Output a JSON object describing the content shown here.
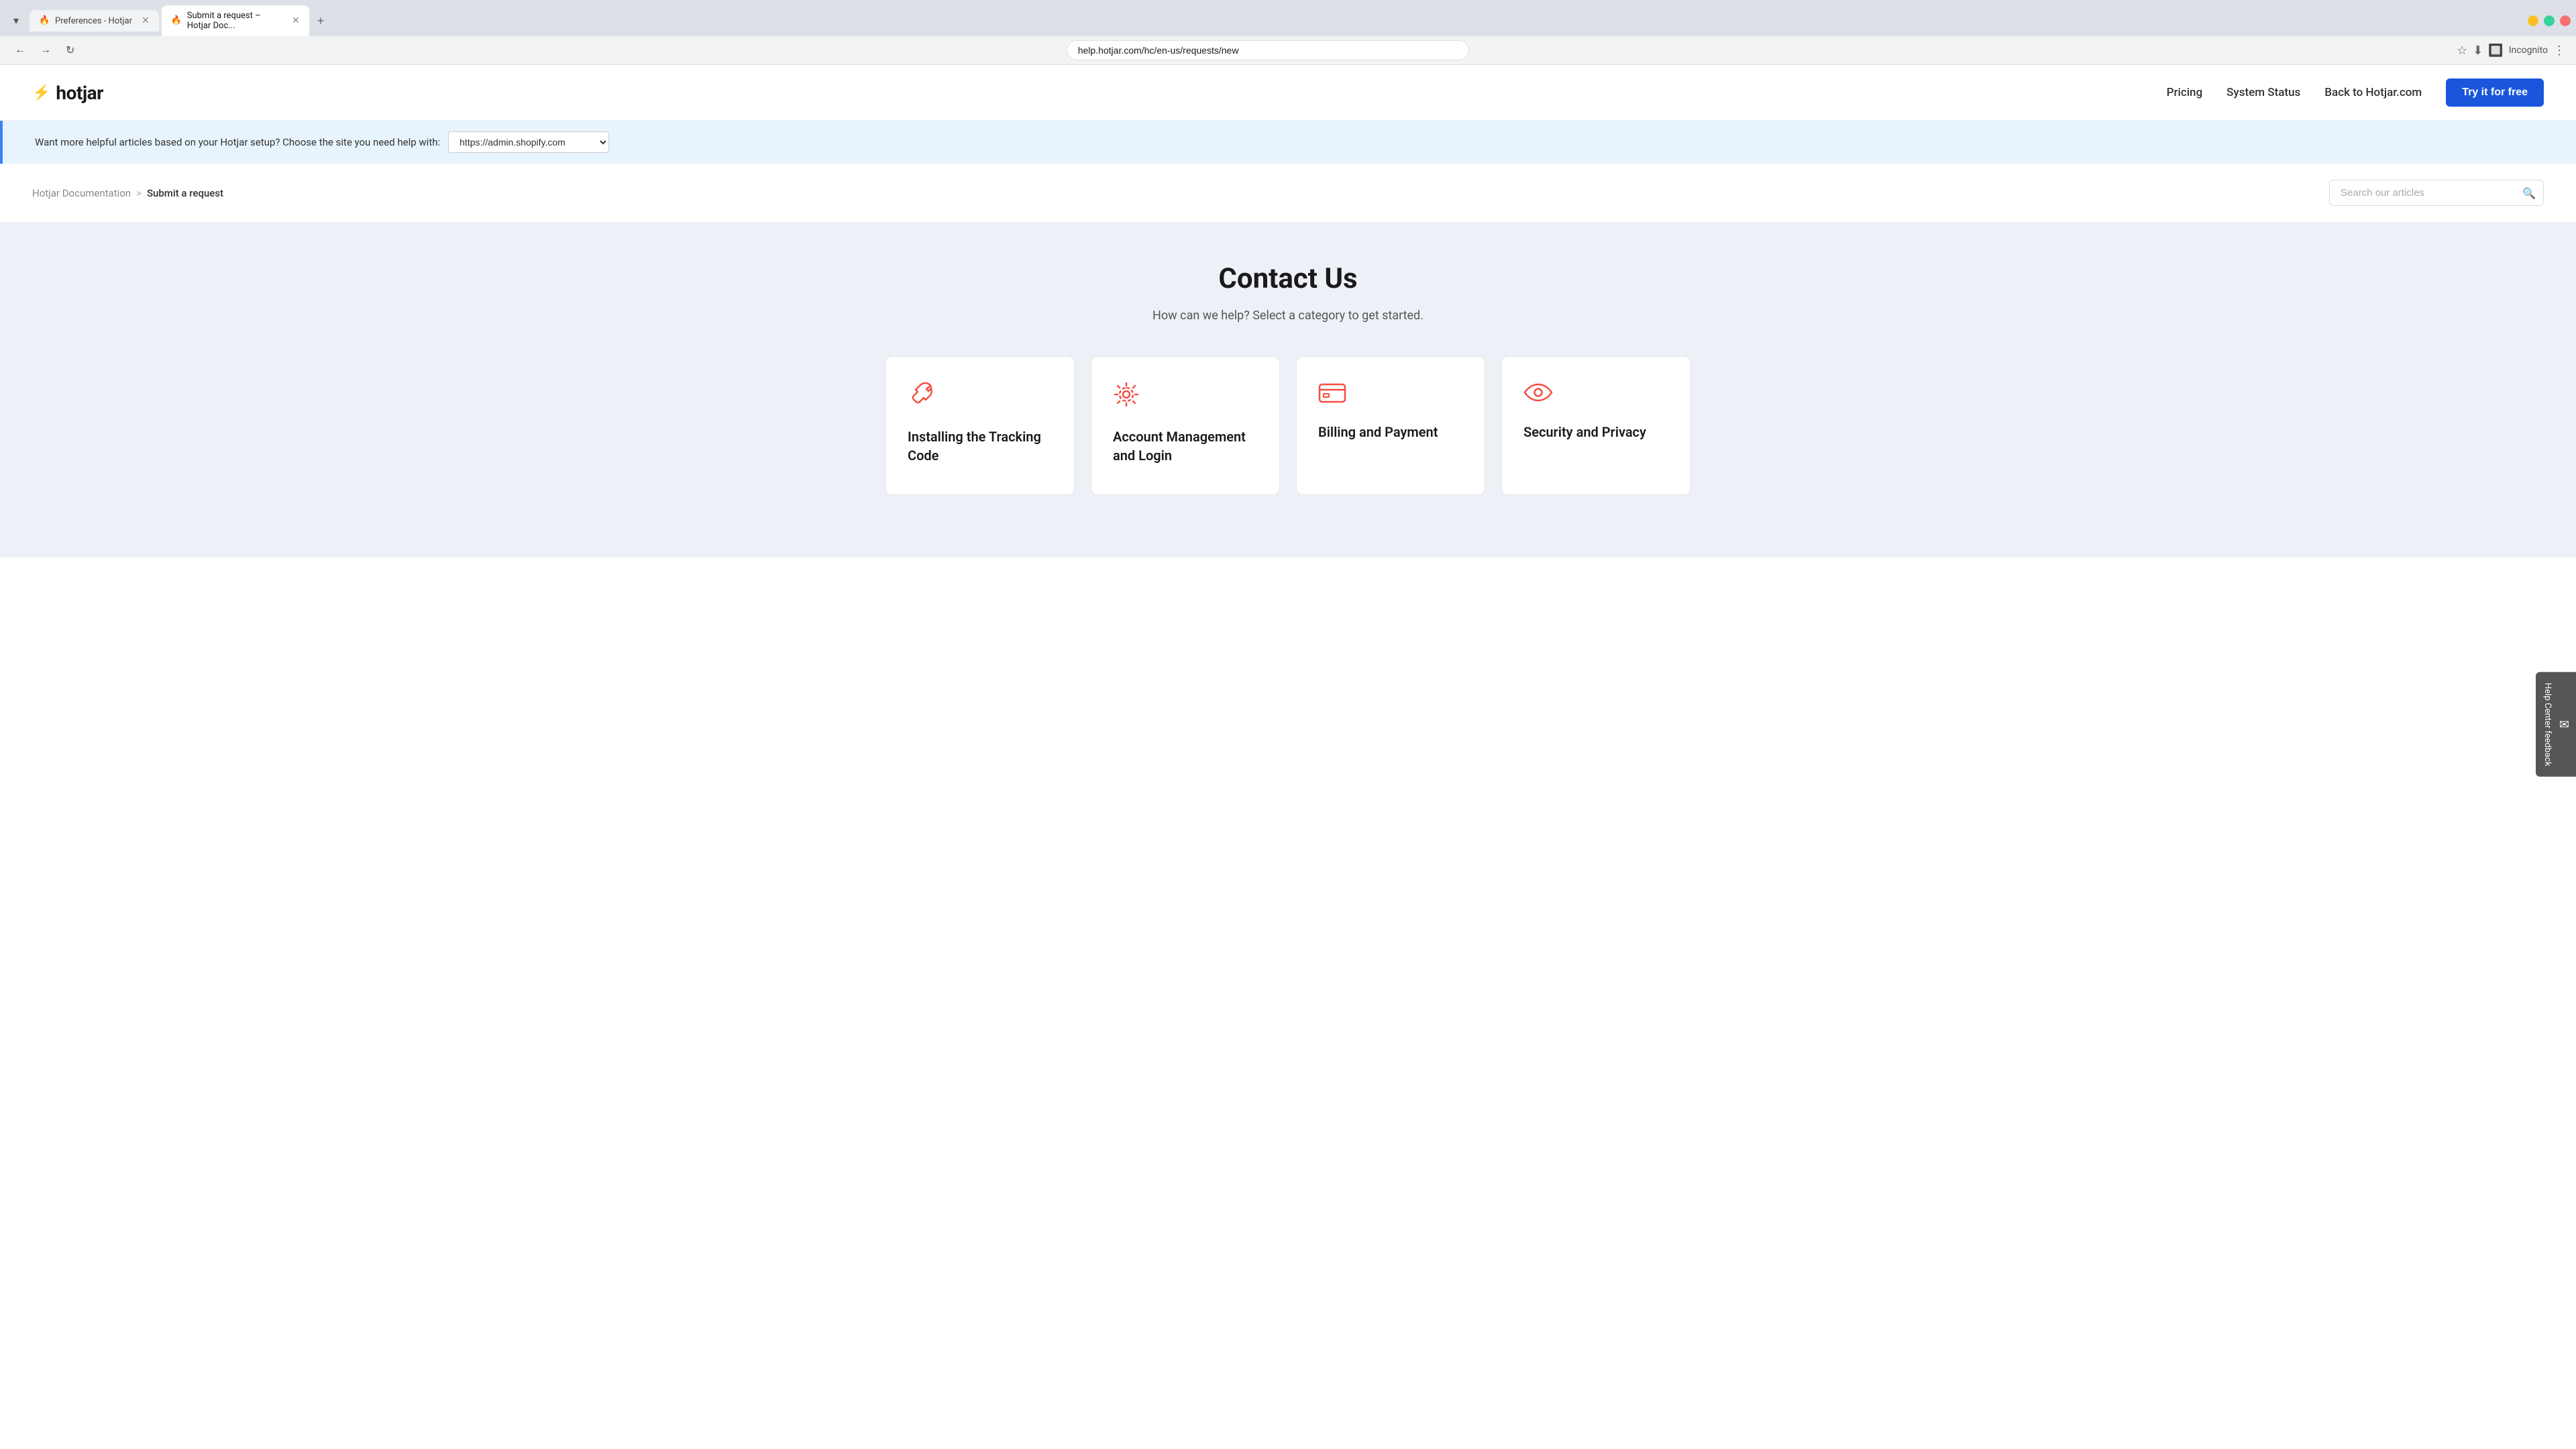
{
  "browser": {
    "tabs": [
      {
        "id": "tab1",
        "title": "Preferences - Hotjar",
        "favicon": "🔥",
        "active": false
      },
      {
        "id": "tab2",
        "title": "Submit a request – Hotjar Doc...",
        "favicon": "🔥",
        "active": true
      }
    ],
    "address": "help.hotjar.com/hc/en-us/requests/new",
    "incognito_label": "Incognito"
  },
  "navbar": {
    "logo_text": "hotjar",
    "links": [
      {
        "label": "Pricing",
        "href": "#"
      },
      {
        "label": "System Status",
        "href": "#"
      },
      {
        "label": "Back to Hotjar.com",
        "href": "#"
      }
    ],
    "cta_label": "Try it for free"
  },
  "banner": {
    "text": "Want more helpful articles based on your Hotjar setup? Choose the site you need help with:",
    "site_value": "https://admin.shopify.com"
  },
  "breadcrumb": {
    "parent_label": "Hotjar Documentation",
    "separator": ">",
    "current_label": "Submit a request"
  },
  "search": {
    "placeholder": "Search our articles"
  },
  "main": {
    "title": "Contact Us",
    "subtitle": "How can we help? Select a category to get started.",
    "cards": [
      {
        "id": "tracking-code",
        "icon": "wrench",
        "label": "Installing the Tracking Code"
      },
      {
        "id": "account-management",
        "icon": "gear",
        "label": "Account Management and Login"
      },
      {
        "id": "billing-payment",
        "icon": "card",
        "label": "Billing and Payment"
      },
      {
        "id": "security-privacy",
        "icon": "eye",
        "label": "Security and Privacy"
      }
    ]
  },
  "feedback_sidebar": {
    "label": "Help Center feedback"
  }
}
